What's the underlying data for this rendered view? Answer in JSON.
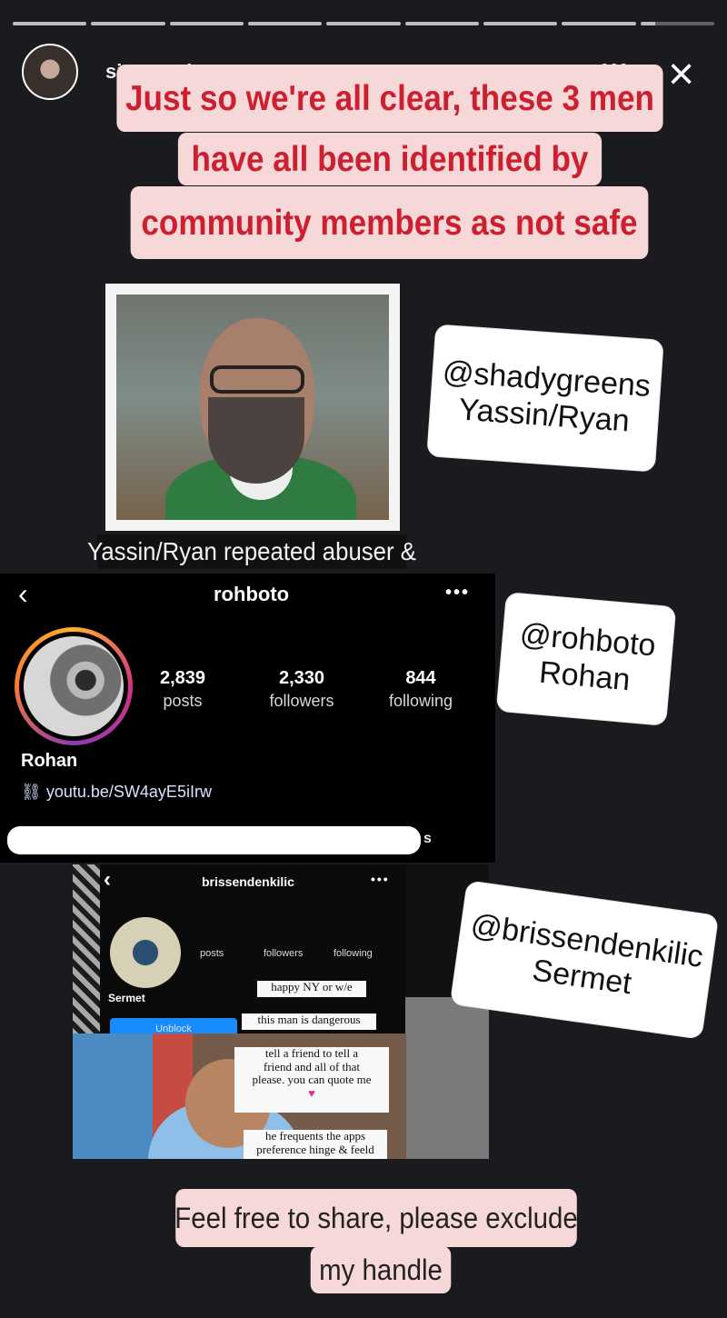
{
  "story": {
    "username": "sistagrrrl_",
    "time": "3m",
    "more_icon": "more-horizontal-icon",
    "close_icon": "close-icon",
    "progress_segments": 9
  },
  "headline_lines": [
    "Just so we're all clear, these 3 men",
    "have all been identified by",
    "community members as not safe"
  ],
  "photo_caption": "Yassin/Ryan repeated abuser &",
  "profile_embed": {
    "back_icon": "chevron-left-icon",
    "username": "rohboto",
    "more_icon": "more-horizontal-icon",
    "stats": [
      {
        "value": "2,839",
        "label": "posts"
      },
      {
        "value": "2,330",
        "label": "followers"
      },
      {
        "value": "844",
        "label": "following"
      }
    ],
    "name": "Rohan",
    "link": "youtu.be/SW4ayE5iIrw",
    "redacted_tail": "s"
  },
  "screenshot3": {
    "back_icon": "chevron-left-icon",
    "username": "brissendenkilic",
    "more_icon": "more-horizontal-icon",
    "stats": [
      "posts",
      "followers",
      "following"
    ],
    "name": "Sermet",
    "button": "Unblock",
    "notes": [
      "happy NY or w/e",
      "this man is dangerous",
      "tell a friend to tell a",
      "friend and all of that",
      "please. you can quote me",
      "he frequents the apps",
      "preference hinge & feeld"
    ]
  },
  "stickers": [
    [
      "@shadygreens",
      "Yassin/Ryan"
    ],
    [
      "@rohboto",
      "Rohan"
    ],
    [
      "@brissendenkilic",
      "Sermet"
    ]
  ],
  "footer_lines": [
    "Feel free to share, please exclude",
    "my handle"
  ]
}
